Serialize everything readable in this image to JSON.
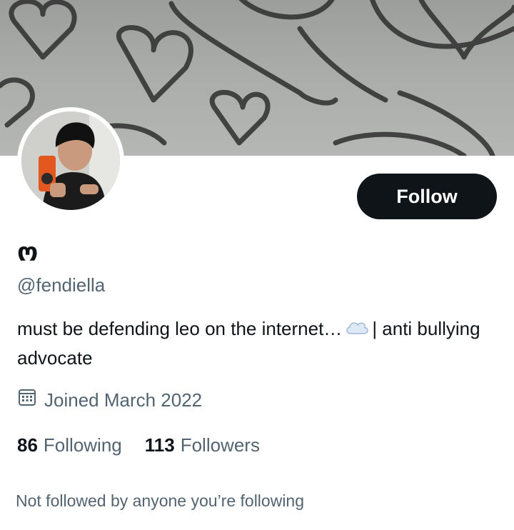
{
  "profile": {
    "display_name": "ო",
    "handle": "@fendiella",
    "bio_before": "must be defending leo on the internet…",
    "bio_after": "| anti bullying advocate",
    "joined": "Joined March 2022",
    "following_count": "86",
    "following_label": "Following",
    "followers_count": "113",
    "followers_label": "Followers",
    "not_followed": "Not followed by anyone you’re following"
  },
  "actions": {
    "follow_label": "Follow"
  },
  "icons": {
    "calendar": "calendar-icon",
    "cloud": "cloud-emoji"
  },
  "colors": {
    "primary_text": "#0f1419",
    "secondary_text": "#536471",
    "button_bg": "#0f1419",
    "background": "#ffffff"
  }
}
